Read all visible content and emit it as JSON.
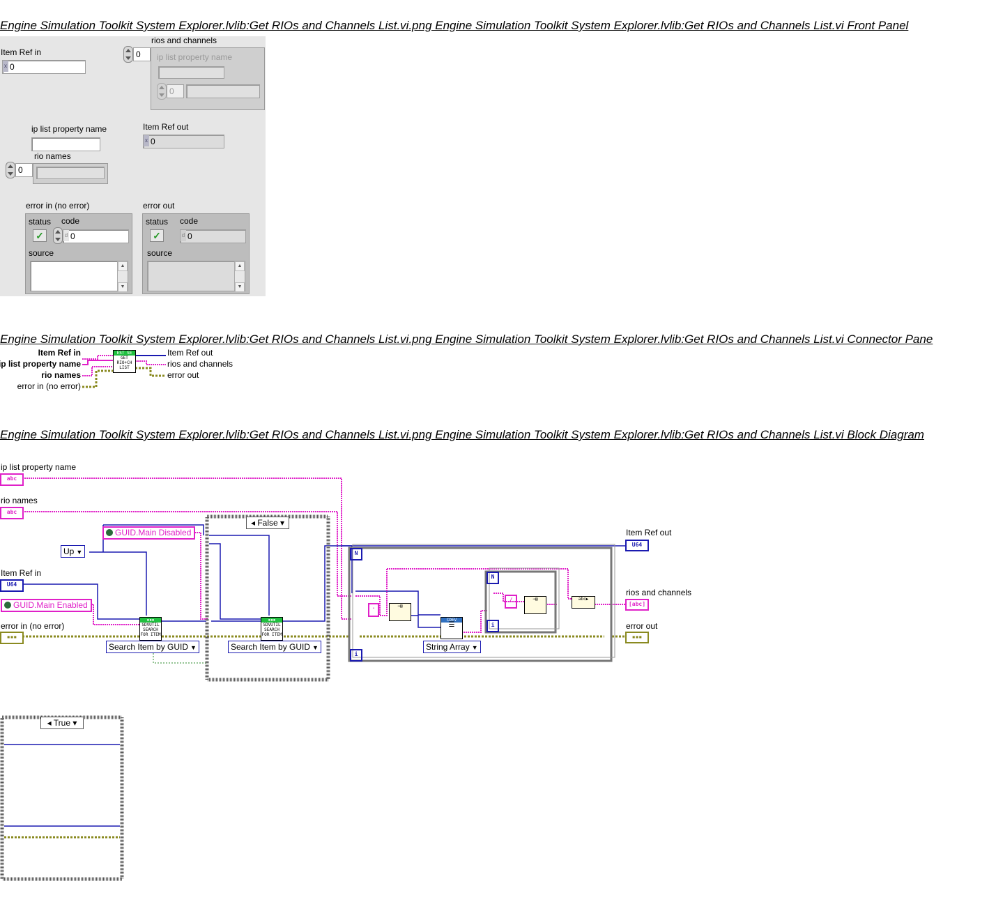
{
  "headings": {
    "front_panel": "Engine Simulation Toolkit System Explorer.lvlib:Get RIOs and Channels List.vi.png  Engine Simulation Toolkit System Explorer.lvlib:Get RIOs and Channels List.vi Front Panel",
    "connector_pane": "Engine Simulation Toolkit System Explorer.lvlib:Get RIOs and Channels List.vi.png  Engine Simulation Toolkit System Explorer.lvlib:Get RIOs and Channels List.vi Connector Pane",
    "block_diagram": "Engine Simulation Toolkit System Explorer.lvlib:Get RIOs and Channels List.vi.png  Engine Simulation Toolkit System Explorer.lvlib:Get RIOs and Channels List.vi Block Diagram"
  },
  "front_panel": {
    "item_ref_in": {
      "label": "Item Ref in",
      "value": "0"
    },
    "rios_and_channels": {
      "label": "rios and channels",
      "index": "0",
      "inner_label": "ip list property name",
      "inner_index": "0"
    },
    "ip_list_property_name": {
      "label": "ip list property name",
      "value": ""
    },
    "rio_names": {
      "label": "rio names",
      "index": "0"
    },
    "item_ref_out": {
      "label": "Item Ref out",
      "value": "0"
    },
    "error_in": {
      "label": "error in (no error)",
      "status_label": "status",
      "code_label": "code",
      "code_value": "0",
      "source_label": "source"
    },
    "error_out": {
      "label": "error out",
      "status_label": "status",
      "code_label": "code",
      "code_value": "0",
      "source_label": "source"
    }
  },
  "connector_pane": {
    "inputs": [
      "Item Ref in",
      "ip list property name",
      "rio names",
      "error in (no error)"
    ],
    "outputs": [
      "Item Ref out",
      "rios and channels",
      "error out"
    ],
    "icon_top": "EST SE",
    "icon_text": "GET RIO+CH LIST"
  },
  "block_diagram": {
    "ip_list_property_name": "ip list property name",
    "rio_names": "rio names",
    "item_ref_in": "Item Ref in",
    "error_in": "error in (no error)",
    "item_ref_out": "Item Ref out",
    "rios_and_channels": "rios and channels",
    "error_out": "error out",
    "abc": "abc",
    "u64": "U64",
    "direction_ring": "Up",
    "guid_disabled": "GUID.Main Disabled",
    "guid_enabled": "GUID.Main Enabled",
    "search_ring_1": "Search Item by GUID",
    "search_ring_2": "Search Item by GUID",
    "string_array_ring": "String Array",
    "case_false": "False",
    "case_true": "True",
    "subvi_text": "SDVUTIL SEARCH FOR ITEM",
    "cdev_text": "CDEV",
    "loop_n": "N",
    "loop_i": "i",
    "slash": "/"
  }
}
